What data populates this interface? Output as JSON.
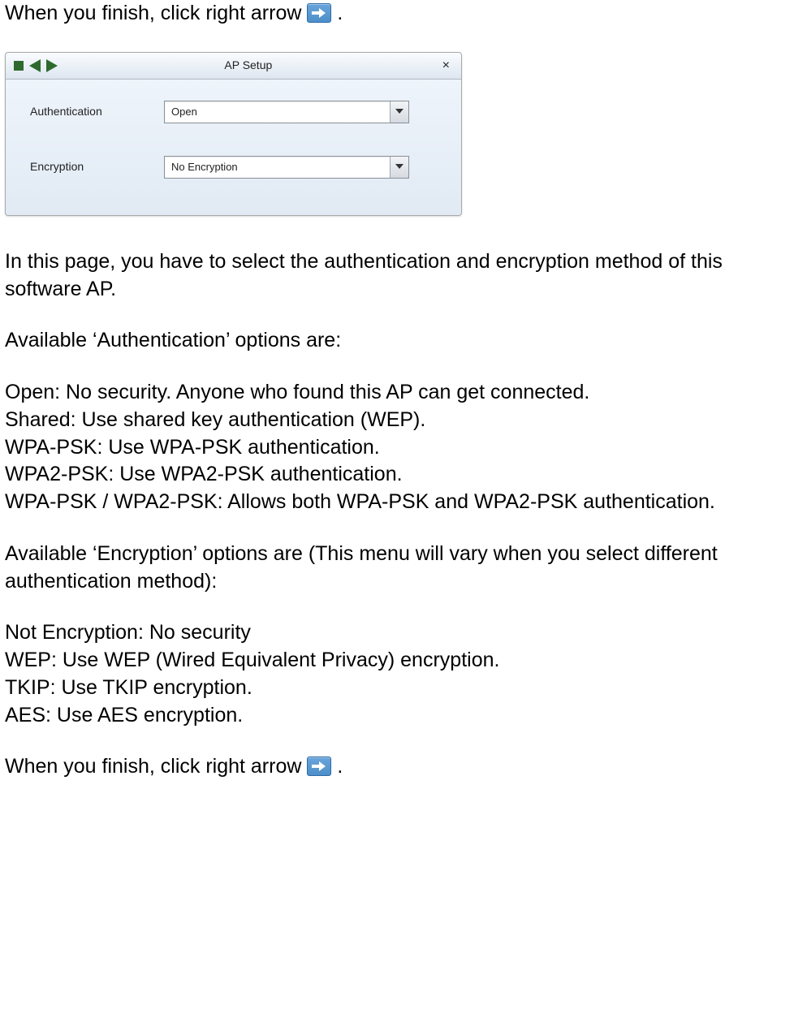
{
  "intro": {
    "line1_pre": "When you finish, click right arrow ",
    "line1_post": " ."
  },
  "window": {
    "title": "AP Setup",
    "fields": {
      "auth_label": "Authentication",
      "auth_value": "Open",
      "enc_label": "Encryption",
      "enc_value": "No Encryption"
    }
  },
  "body": {
    "p1": "In this page, you have to select the authentication and encryption method of this software AP.",
    "auth_heading": "Available ‘Authentication’ options are:",
    "auth_opts": [
      "Open: No security. Anyone who found this AP can get connected.",
      "Shared: Use shared key authentication (WEP).",
      "WPA-PSK: Use WPA-PSK authentication.",
      "WPA2-PSK: Use WPA2-PSK authentication.",
      "WPA-PSK / WPA2-PSK: Allows both WPA-PSK and WPA2-PSK authentication."
    ],
    "enc_heading": "Available ‘Encryption’ options are (This menu will vary when you select different authentication method):",
    "enc_opts": [
      "Not Encryption: No security",
      "WEP: Use WEP (Wired Equivalent Privacy) encryption.",
      "TKIP: Use TKIP encryption.",
      "AES: Use AES encryption."
    ],
    "outro_pre": "When you finish, click right arrow ",
    "outro_post": " ."
  }
}
